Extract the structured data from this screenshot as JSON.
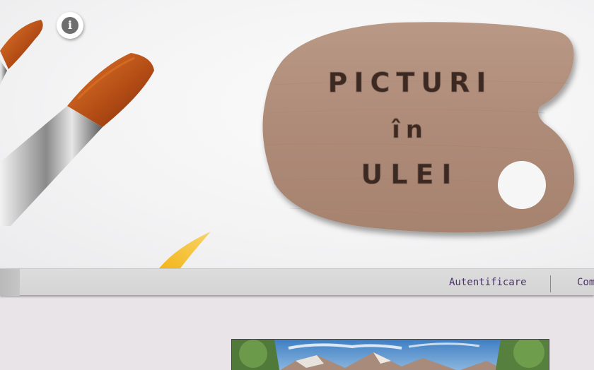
{
  "hero": {
    "logo_lines": [
      "PICTURI",
      "în",
      "ULEI"
    ],
    "info_icon": "info-icon",
    "info_glyph": "i"
  },
  "nav": {
    "items": [
      {
        "label": "Autentificare"
      },
      {
        "label": "Com"
      }
    ]
  },
  "colors": {
    "nav_text": "#4b3266",
    "wood": "#b28f7c",
    "page_bg": "#e9e4e8"
  }
}
